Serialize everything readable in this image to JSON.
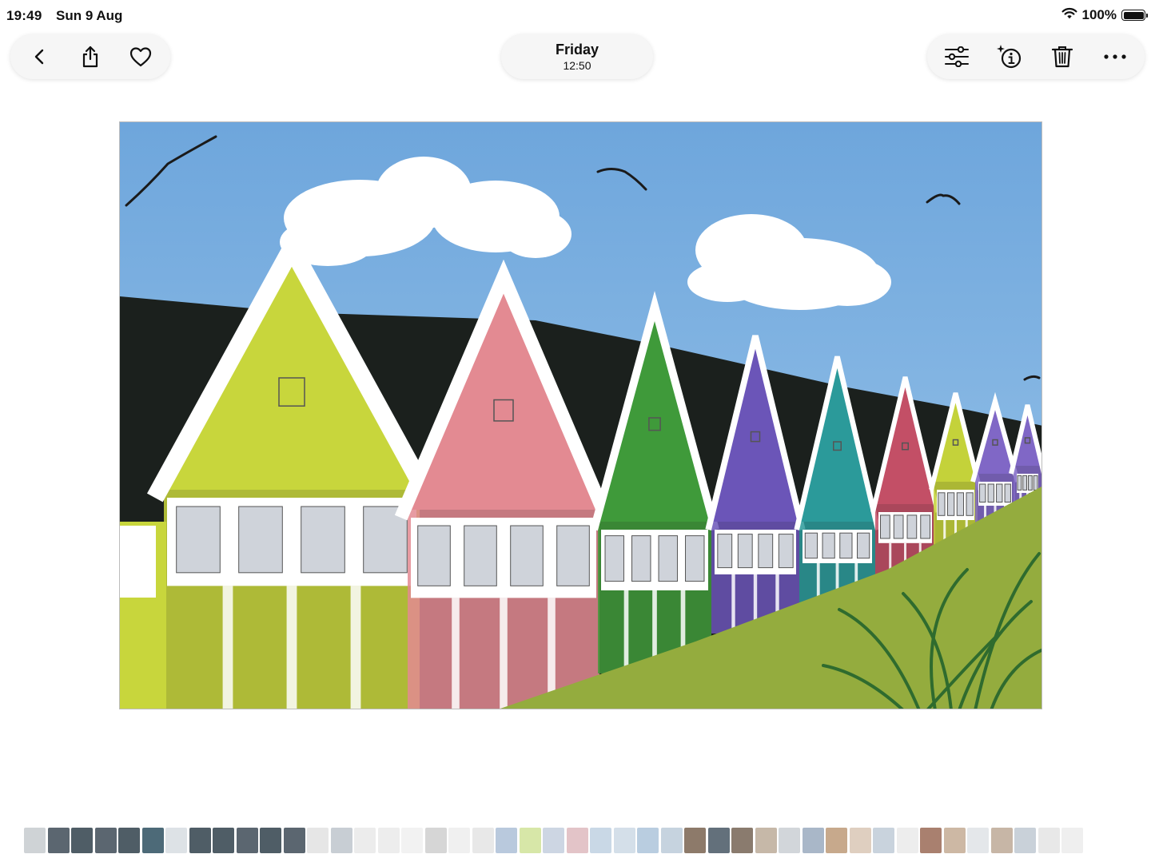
{
  "status": {
    "time": "19:49",
    "date": "Sun 9 Aug",
    "battery": "100%",
    "battery_level": 1.0
  },
  "toolbar": {
    "title": "Friday",
    "subtitle": "12:50",
    "left_icons": [
      "chevron-left-icon",
      "share-icon",
      "heart-icon"
    ],
    "right_icons": [
      "adjustments-icon",
      "info-sparkle-icon",
      "trash-icon",
      "more-icon"
    ]
  },
  "colors": {
    "sky": "#7fb2e0",
    "hill": "#1a1f1c",
    "grass": "#93aa3c",
    "hut_yellow": "#c8d63c",
    "hut_pink": "#e38a92",
    "hut_green": "#3f9a3a",
    "hut_purple": "#6b55b8",
    "hut_teal": "#2b9a9a",
    "hut_red": "#c34f66",
    "hut_lime": "#c4d23a",
    "hut_violet": "#8067c6"
  },
  "filmstrip": {
    "thumbs": [
      "#cfd3d6",
      "#5b6670",
      "#4f5d66",
      "#5b6670",
      "#4f5d66",
      "#4d6a78",
      "#dde2e6",
      "#4f5d66",
      "#4f5d66",
      "#5b6670",
      "#4f5d66",
      "#5b6670",
      "#e6e6e6",
      "#c8ced4",
      "#ececec",
      "#ededed",
      "#f2f2f2",
      "#d6d6d6",
      "#f0f0f0",
      "#e8e8e8",
      "#b9c9dd",
      "#d7e7a8",
      "#cdd6e3",
      "#e3c4c8",
      "#c9d8e6",
      "#d4dfe9",
      "#b9cde0",
      "#c6d3df",
      "#8d7a6a",
      "#63707b",
      "#8a7b6e",
      "#c6b8a8",
      "#d2d6da",
      "#a9b7c8",
      "#c7a98c",
      "#dfcfc0",
      "#c9d3dd",
      "#ededed",
      "#a9806f",
      "#cdb8a4",
      "#e4e7ea",
      "#c7b6a6",
      "#c9d1d9",
      "#e8e8e8",
      "#efefef"
    ]
  }
}
